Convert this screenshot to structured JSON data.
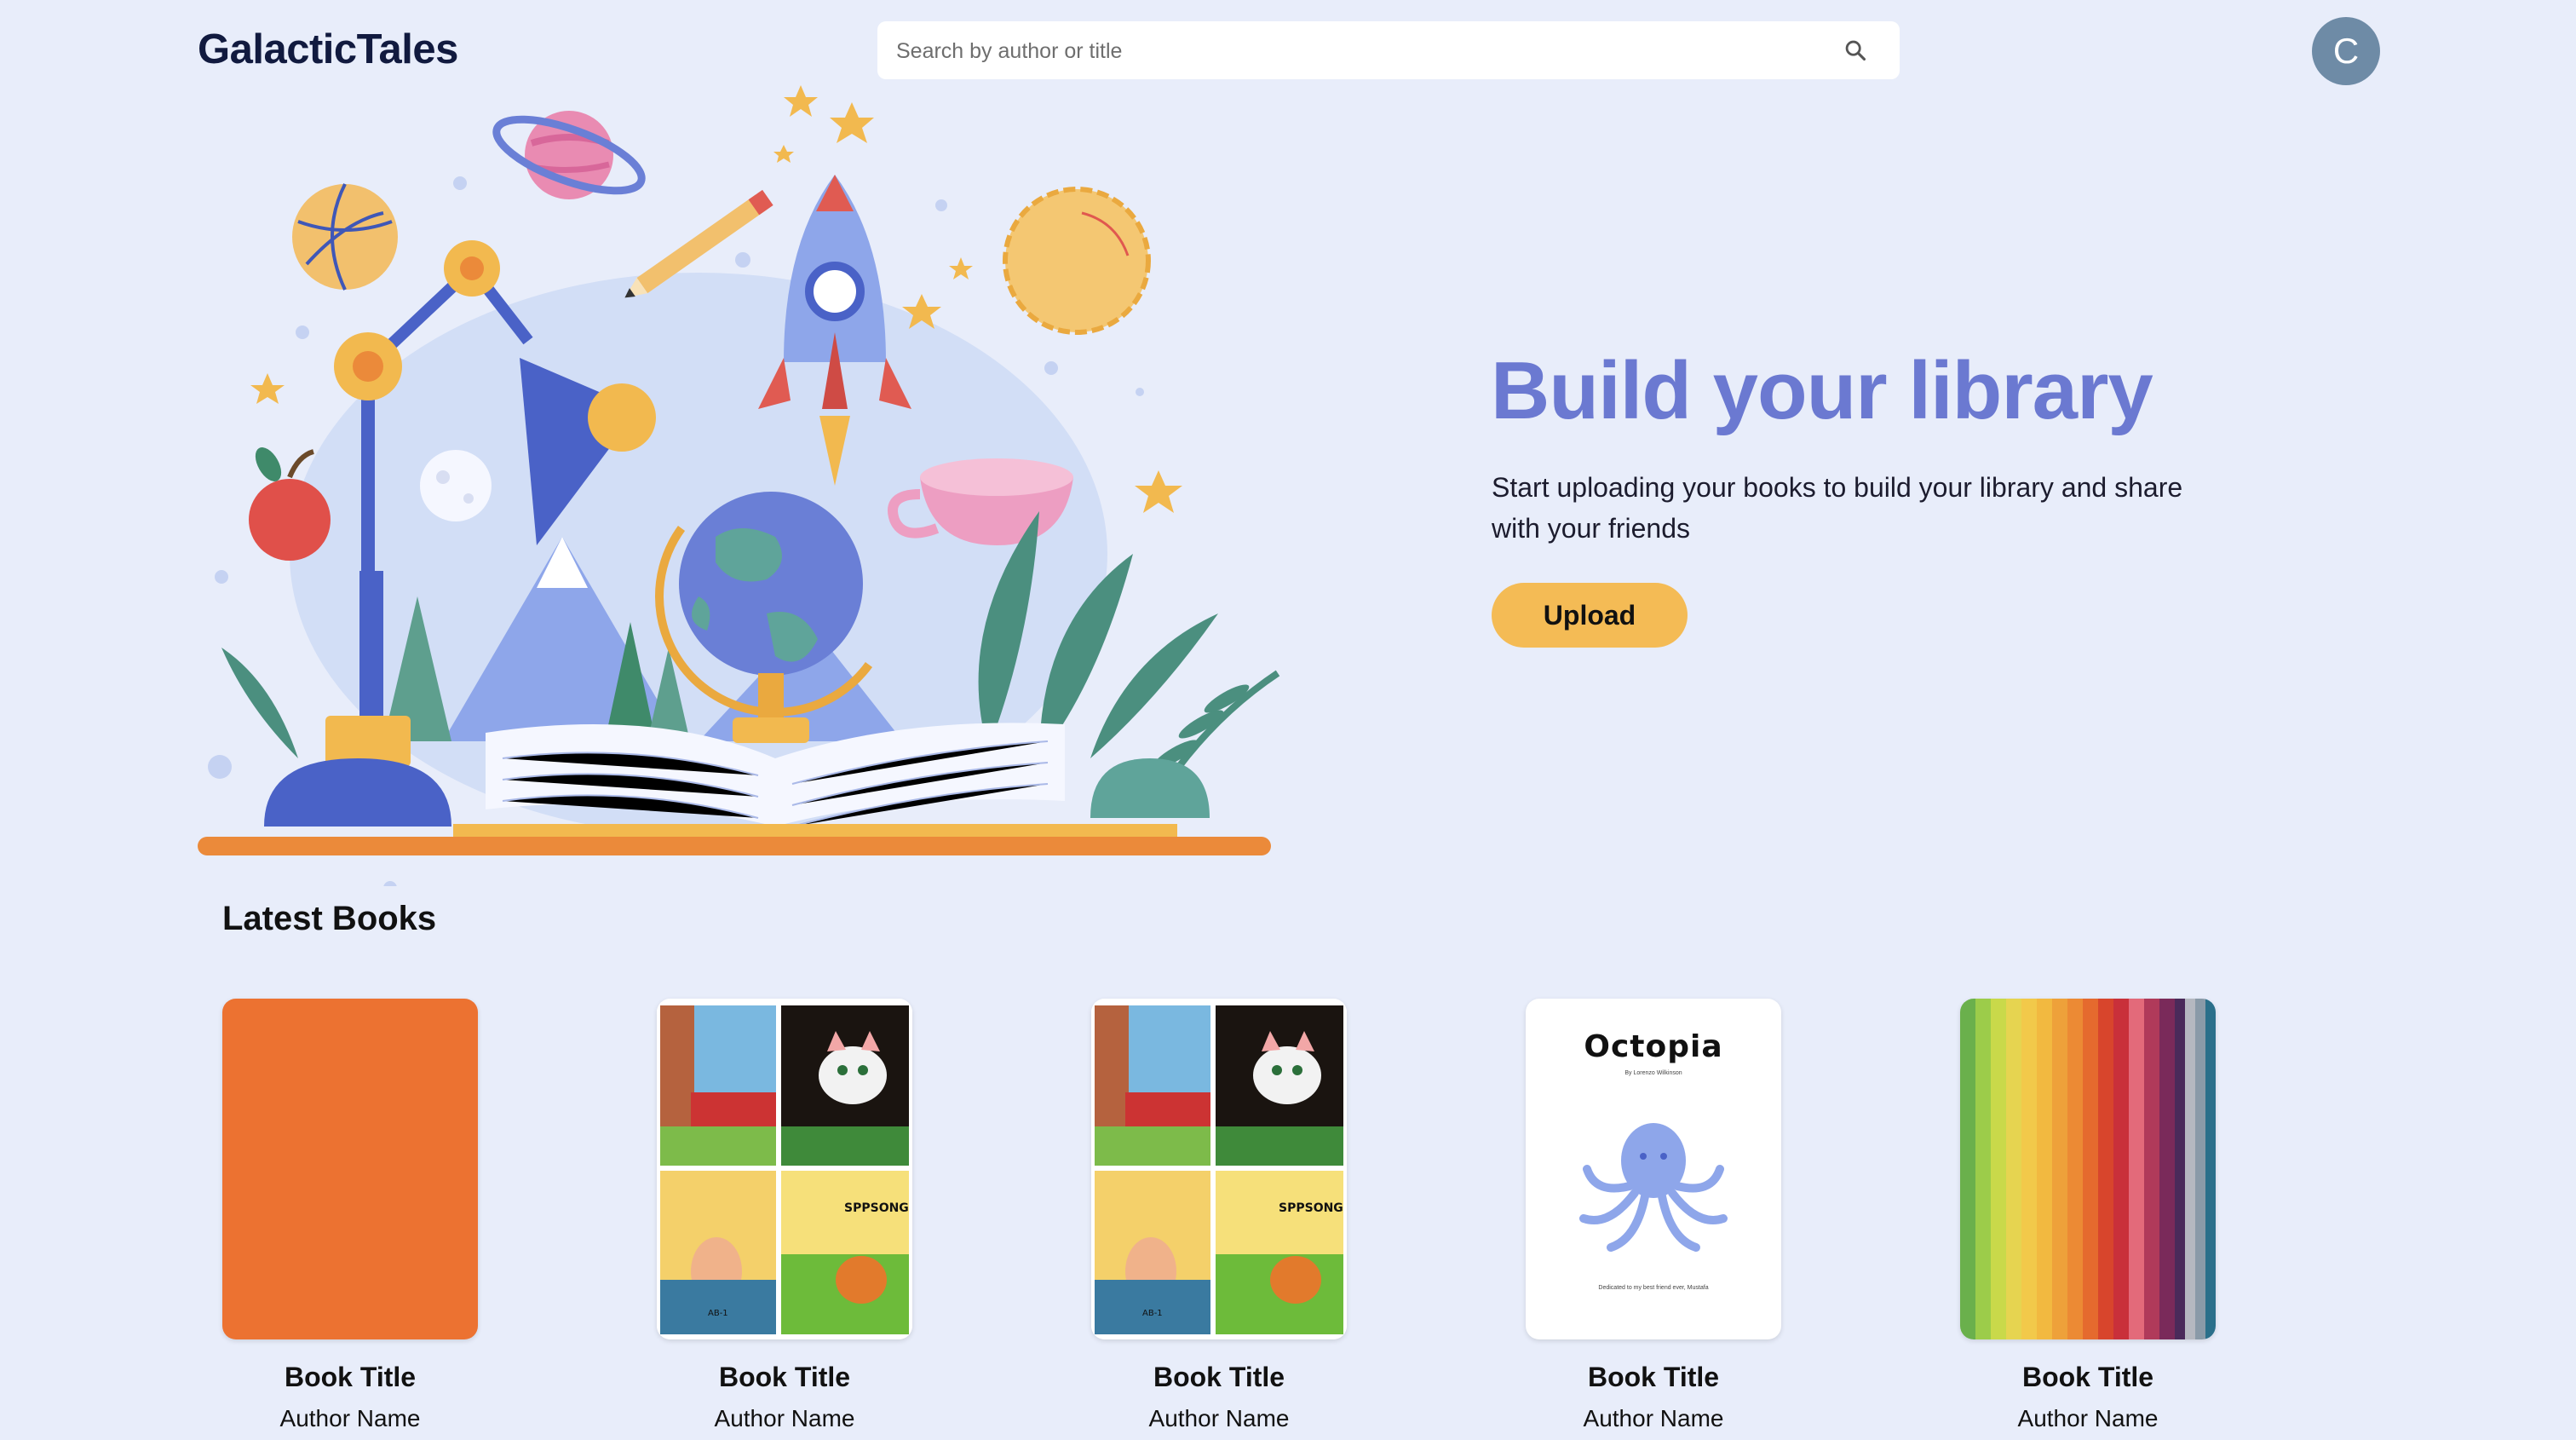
{
  "header": {
    "logo": "GalacticTales",
    "search_placeholder": "Search by author or title",
    "avatar_initial": "C"
  },
  "hero": {
    "title": "Build your library",
    "subtitle": "Start uploading your books to build your library and share with your friends",
    "upload_label": "Upload"
  },
  "latest": {
    "heading": "Latest Books",
    "books": [
      {
        "title": "Book Title",
        "author": "Author Name",
        "cover": "solid-orange"
      },
      {
        "title": "Book Title",
        "author": "Author Name",
        "cover": "comic-cats"
      },
      {
        "title": "Book Title",
        "author": "Author Name",
        "cover": "comic-cats"
      },
      {
        "title": "Book Title",
        "author": "Author Name",
        "cover": "octopia",
        "cover_text": {
          "title": "Octopia",
          "byline": "By Lorenzo Wilkinson",
          "dedication": "Dedicated to my best friend ever, Mustafa"
        }
      },
      {
        "title": "Book Title",
        "author": "Author Name",
        "cover": "rainbow-stripes"
      }
    ]
  },
  "comic_text": {
    "sound": "SPPSONG",
    "plate": "AB-1"
  },
  "colors": {
    "background": "#e8edfa",
    "accent": "#6b79d1",
    "button": "#f4bb55",
    "avatar": "#6e8ba6",
    "orange_cover": "#ec7231"
  }
}
